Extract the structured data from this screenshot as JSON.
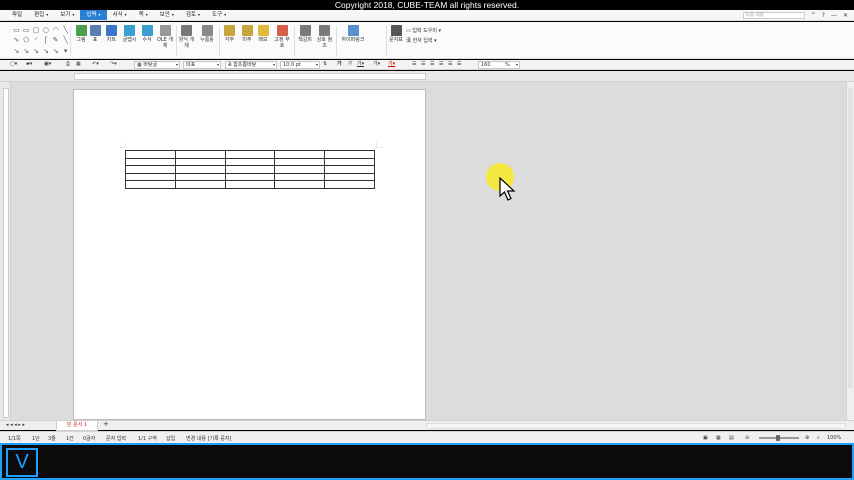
{
  "copyright": "Copyright 2018, CUBE-TEAM all rights reserved.",
  "menu": {
    "items": [
      {
        "label": "파일",
        "arrow": ""
      },
      {
        "label": "편집",
        "arrow": "▾"
      },
      {
        "label": "보기",
        "arrow": "▾"
      },
      {
        "label": "입력",
        "arrow": "▾"
      },
      {
        "label": "서식",
        "arrow": "▾"
      },
      {
        "label": "쪽",
        "arrow": "▾"
      },
      {
        "label": "보안",
        "arrow": "▾"
      },
      {
        "label": "검토",
        "arrow": "▾"
      },
      {
        "label": "도구",
        "arrow": "▾"
      }
    ],
    "active_index": 3,
    "help_placeholder": "도움 내용",
    "window_controls": [
      "^",
      "?",
      "—",
      "✕"
    ]
  },
  "ribbon": {
    "buttons": [
      {
        "label": "그림",
        "color": "#4c9f4c"
      },
      {
        "label": "표",
        "color": "#5b7fb5"
      },
      {
        "label": "차트",
        "color": "#3c76c9"
      },
      {
        "label": "글맵시",
        "color": "#3a9fd0"
      },
      {
        "label": "수식",
        "color": "#3a9fd0"
      },
      {
        "label": "OLE 개체",
        "color": "#999999"
      },
      {
        "label": "양식 개체",
        "color": "#777777"
      },
      {
        "label": "누름틀",
        "color": "#888888"
      },
      {
        "label": "각주",
        "color": "#c9a43a"
      },
      {
        "label": "미주",
        "color": "#c9a43a"
      },
      {
        "label": "메모",
        "color": "#e3b93a"
      },
      {
        "label": "고정 부호",
        "color": "#d65f4a"
      },
      {
        "label": "책갈피",
        "color": "#7a7a7a"
      },
      {
        "label": "상호 참조",
        "color": "#7a7a7a"
      },
      {
        "label": "하이퍼링크",
        "color": "#5a8fcf"
      },
      {
        "label": "문자표",
        "color": "#555555"
      }
    ],
    "side_items": [
      "입력 도우미",
      "한자 입력"
    ]
  },
  "format": {
    "style": "바탕글",
    "lang": "대표",
    "font": "함초롬바탕",
    "size": "10.0",
    "size_unit": "pt",
    "zoom": "160",
    "zoom_unit": "%"
  },
  "tabs": {
    "doc_tab": "빈 문서 1",
    "add": "+"
  },
  "status": {
    "page": "1/1쪽",
    "column": "1단",
    "line": "3줄",
    "col": "1칸",
    "chars": "0글자",
    "mode": "문자 입력",
    "section": "1/1 구역",
    "insert": "삽입",
    "track": "변경 내용 [기록 중지]",
    "zoom": "100%"
  },
  "table": {
    "rows": 5,
    "cols": 5
  },
  "logo_letter": "V"
}
